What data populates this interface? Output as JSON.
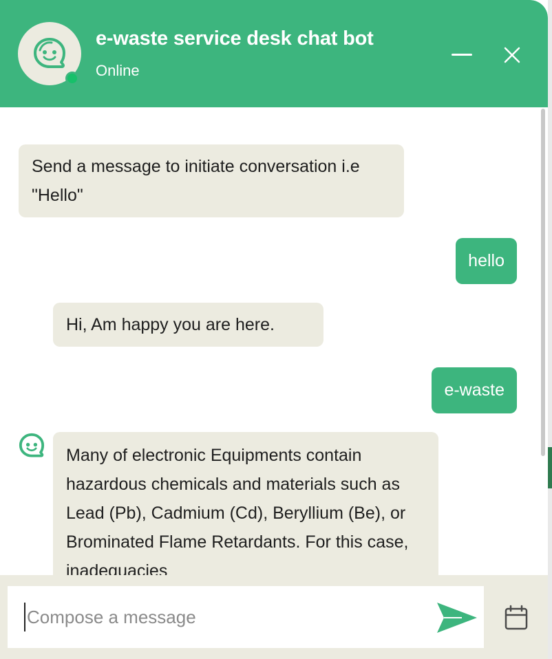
{
  "header": {
    "title": "e-waste service desk chat bot",
    "status": "Online",
    "avatar_icon": "smiling-bot-icon",
    "minimize_icon": "minimize-icon",
    "close_icon": "close-icon"
  },
  "messages": [
    {
      "sender": "bot",
      "text": "Send a message to initiate conversation i.e \"Hello\""
    },
    {
      "sender": "user",
      "text": "hello"
    },
    {
      "sender": "bot",
      "text": "Hi, Am happy you are here."
    },
    {
      "sender": "user",
      "text": "e-waste"
    },
    {
      "sender": "bot",
      "text": "Many of electronic Equipments contain hazardous chemicals and materials such as Lead (Pb), Cadmium (Cd), Beryllium (Be), or Brominated Flame Retardants. For this case, inadequacies"
    }
  ],
  "composer": {
    "placeholder": "Compose a message",
    "send_icon": "send-icon",
    "calendar_icon": "calendar-icon"
  },
  "colors": {
    "brand": "#3db57e",
    "bot_bubble": "#ecebe0",
    "online": "#17c06a"
  }
}
